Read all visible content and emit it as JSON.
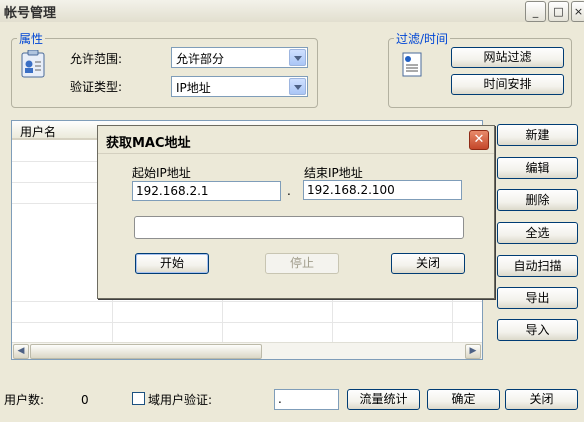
{
  "window": {
    "title": "帐号管理",
    "min_glyph": "_",
    "max_glyph": "□",
    "close_glyph": "×"
  },
  "properties_group": {
    "label": "属性",
    "scope_label": "允许范围:",
    "scope_value": "允许部分",
    "auth_label": "验证类型:",
    "auth_value": "IP地址"
  },
  "filter_group": {
    "label": "过滤/时间",
    "web_filter": "网站过滤",
    "schedule": "时间安排"
  },
  "list": {
    "column_user": "用户名"
  },
  "side_buttons": [
    "新建",
    "编辑",
    "删除",
    "全选",
    "自动扫描",
    "导出",
    "导入"
  ],
  "footer": {
    "user_count_label": "用户数:",
    "user_count": "0",
    "domain_auth_label": "域用户验证:",
    "domain_field_value": ".",
    "traffic_stats": "流量统计",
    "ok": "确定",
    "close": "关闭"
  },
  "dialog": {
    "title": "获取MAC地址",
    "start_ip_label": "起始IP地址",
    "start_ip_value": "192.168.2.1",
    "separator": ".",
    "end_ip_label": "结束IP地址",
    "end_ip_value": "192.168.2.100",
    "status_value": "",
    "start_button": "开始",
    "stop_button": "停止",
    "close_button": "关闭"
  },
  "colors": {
    "window_bg": "#ECE9D8",
    "group_label": "#0046d5",
    "dialog_close": "#c4472a"
  },
  "icons": [
    "user-card-icon",
    "document-icon"
  ]
}
